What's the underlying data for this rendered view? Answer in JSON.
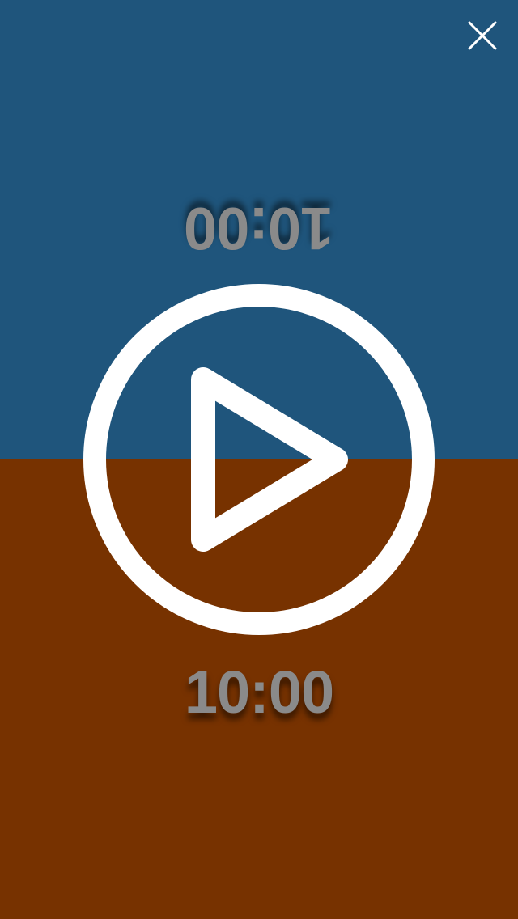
{
  "player_top": {
    "timer": "10:00",
    "color": "#1f557c"
  },
  "player_bottom": {
    "timer": "10:00",
    "color": "#773200"
  },
  "controls": {
    "close_icon": "close-icon",
    "play_icon": "play-icon",
    "icon_color": "#ffffff"
  }
}
